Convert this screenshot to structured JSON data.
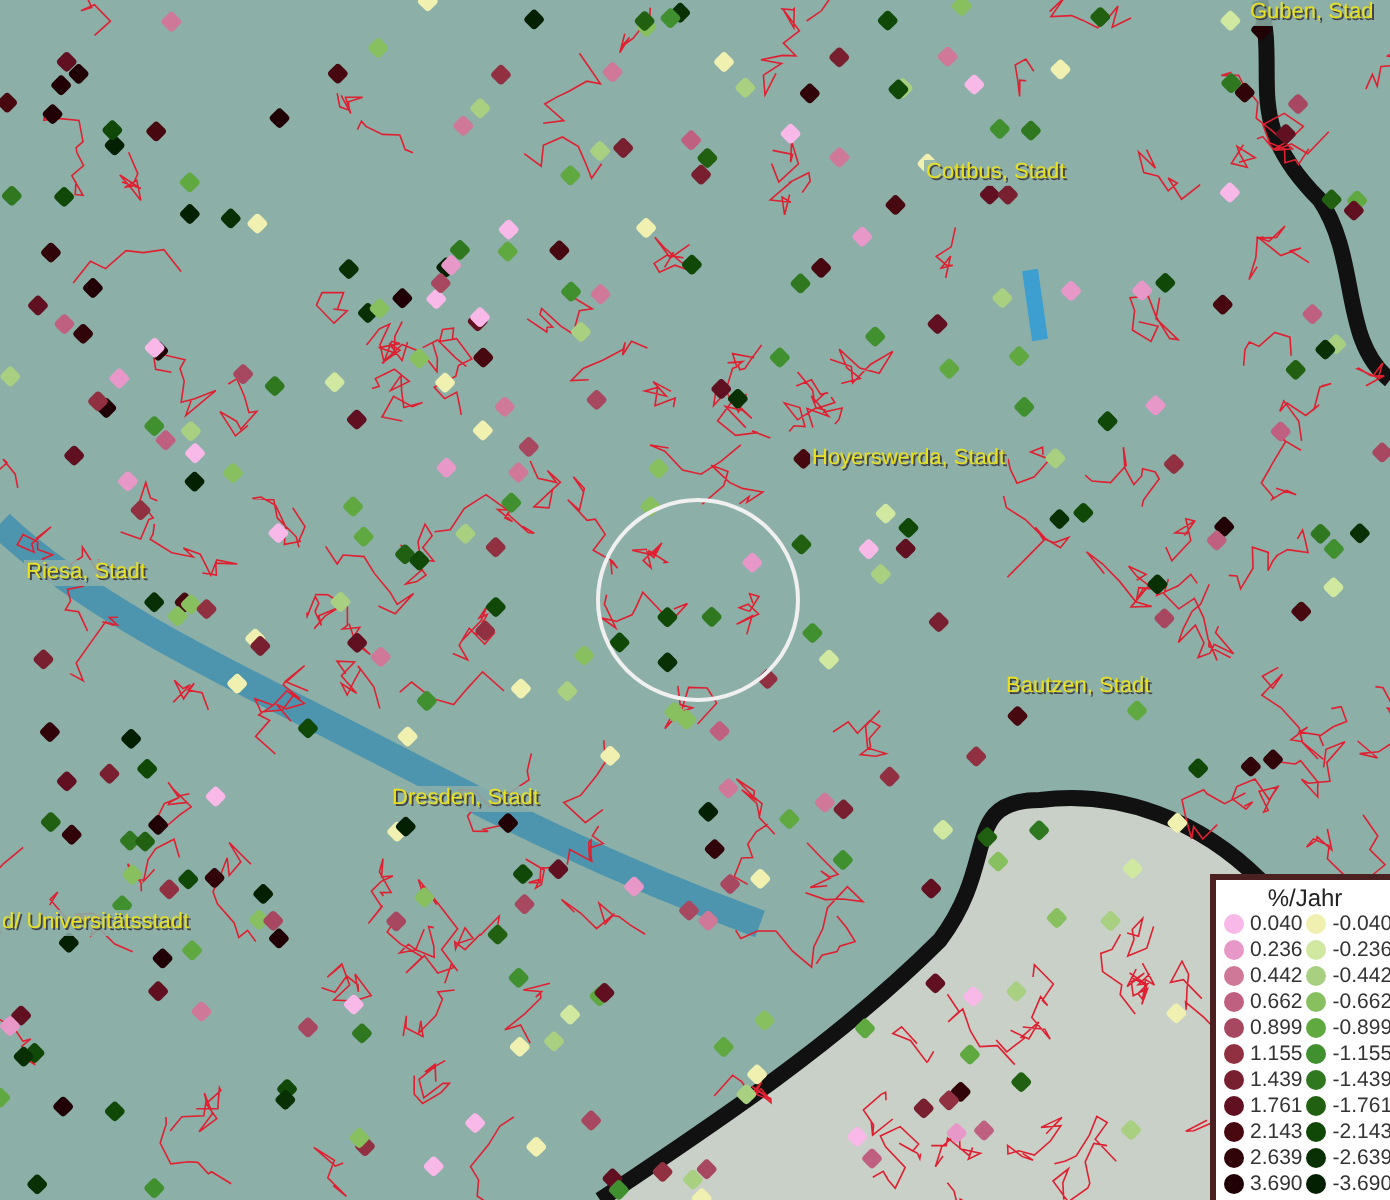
{
  "map": {
    "places": [
      {
        "name": "Guben, Stad"
      },
      {
        "name": "Cottbus, Stadt"
      },
      {
        "name": "Hoyerswerda, Stadt"
      },
      {
        "name": "Riesa, Stadt"
      },
      {
        "name": "Bautzen, Stadt"
      },
      {
        "name": "Dresden, Stadt"
      },
      {
        "name": "d/ Universitätsstadt"
      }
    ]
  },
  "legend": {
    "title": "%/Jahr",
    "entries": [
      {
        "label": "0.040",
        "color": "#f8b8e8"
      },
      {
        "label": "-0.040",
        "color": "#f0f0b0"
      },
      {
        "label": "0.236",
        "color": "#e898c8"
      },
      {
        "label": "-0.236",
        "color": "#d0e8a0"
      },
      {
        "label": "0.442",
        "color": "#d07898"
      },
      {
        "label": "-0.442",
        "color": "#a8d080"
      },
      {
        "label": "0.662",
        "color": "#c06080"
      },
      {
        "label": "-0.662",
        "color": "#88c060"
      },
      {
        "label": "0.899",
        "color": "#a84860"
      },
      {
        "label": "-0.899",
        "color": "#60a840"
      },
      {
        "label": "1.155",
        "color": "#903040"
      },
      {
        "label": "-1.155",
        "color": "#409030"
      },
      {
        "label": "1.439",
        "color": "#782030"
      },
      {
        "label": "-1.439",
        "color": "#307820"
      },
      {
        "label": "1.761",
        "color": "#601020"
      },
      {
        "label": "-1.761",
        "color": "#206010"
      },
      {
        "label": "2.143",
        "color": "#480810"
      },
      {
        "label": "-2.143",
        "color": "#104808"
      },
      {
        "label": "2.639",
        "color": "#300408"
      },
      {
        "label": "-2.639",
        "color": "#083004"
      },
      {
        "label": "3.690",
        "color": "#200004"
      },
      {
        "label": "-3.690",
        "color": "#042002"
      }
    ]
  }
}
